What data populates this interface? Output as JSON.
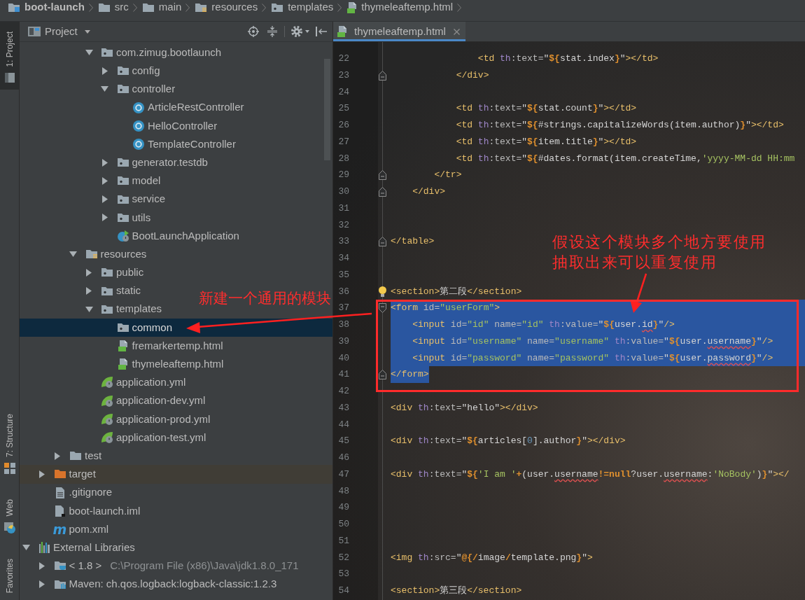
{
  "breadcrumbs": [
    {
      "label": "boot-launch",
      "kind": "module"
    },
    {
      "label": "src",
      "kind": "folder"
    },
    {
      "label": "main",
      "kind": "folder"
    },
    {
      "label": "resources",
      "kind": "resources"
    },
    {
      "label": "templates",
      "kind": "package"
    },
    {
      "label": "thymeleaftemp.html",
      "kind": "html"
    }
  ],
  "tool_strip": [
    {
      "label": "1: Project",
      "kind": "project",
      "selected": true
    },
    {
      "label": "7: Structure",
      "kind": "structure",
      "selected": false
    },
    {
      "label": "Web",
      "kind": "web",
      "selected": false
    },
    {
      "label": "Favorites",
      "kind": "favorites",
      "selected": false
    }
  ],
  "project_panel": {
    "title": "Project",
    "tree": [
      {
        "children": [
          {
            "children": [
              {
                "children": [
                  {
                    "children": [
                      {
                        "label": "com.zimug.bootlaunch",
                        "kind": "package",
                        "expanded": true,
                        "selected": false,
                        "children": [
                          {
                            "label": "config",
                            "kind": "package",
                            "expanded": false,
                            "selected": false
                          },
                          {
                            "label": "controller",
                            "kind": "package",
                            "expanded": true,
                            "selected": false,
                            "children": [
                              {
                                "label": "ArticleRestController",
                                "kind": "class",
                                "selected": false
                              },
                              {
                                "label": "HelloController",
                                "kind": "class",
                                "selected": false
                              },
                              {
                                "label": "TemplateController",
                                "kind": "class",
                                "selected": false
                              }
                            ]
                          },
                          {
                            "label": "generator.testdb",
                            "kind": "package",
                            "expanded": false,
                            "selected": false
                          },
                          {
                            "label": "model",
                            "kind": "package",
                            "expanded": false,
                            "selected": false
                          },
                          {
                            "label": "service",
                            "kind": "package",
                            "expanded": false,
                            "selected": false
                          },
                          {
                            "label": "utils",
                            "kind": "package",
                            "expanded": false,
                            "selected": false
                          },
                          {
                            "label": "BootLaunchApplication",
                            "kind": "boot-class",
                            "selected": false
                          }
                        ]
                      }
                    ]
                  },
                  {
                    "label": "resources",
                    "kind": "resources",
                    "expanded": true,
                    "selected": false,
                    "children": [
                      {
                        "label": "public",
                        "kind": "package",
                        "expanded": false,
                        "selected": false
                      },
                      {
                        "label": "static",
                        "kind": "package",
                        "expanded": false,
                        "selected": false
                      },
                      {
                        "label": "templates",
                        "kind": "package",
                        "expanded": true,
                        "selected": false,
                        "children": [
                          {
                            "label": "common",
                            "kind": "package",
                            "selected": true
                          },
                          {
                            "label": "fremarkertemp.html",
                            "kind": "html",
                            "selected": false
                          },
                          {
                            "label": "thymeleaftemp.html",
                            "kind": "html",
                            "selected": false
                          }
                        ]
                      },
                      {
                        "label": "application.yml",
                        "kind": "spring-config",
                        "selected": false
                      },
                      {
                        "label": "application-dev.yml",
                        "kind": "spring-config",
                        "selected": false
                      },
                      {
                        "label": "application-prod.yml",
                        "kind": "spring-config",
                        "selected": false
                      },
                      {
                        "label": "application-test.yml",
                        "kind": "spring-config",
                        "selected": false
                      }
                    ]
                  }
                ]
              },
              {
                "label": "test",
                "kind": "folder",
                "expanded": false,
                "selected": false
              }
            ]
          },
          {
            "label": "target",
            "kind": "excluded-folder",
            "expanded": false,
            "selected": false
          },
          {
            "label": ".gitignore",
            "kind": "text-file",
            "selected": false
          },
          {
            "label": "boot-launch.iml",
            "kind": "module-file",
            "selected": false
          },
          {
            "label": "pom.xml",
            "kind": "maven",
            "glyph": "m",
            "selected": false
          }
        ]
      },
      {
        "label": "External Libraries",
        "kind": "libraries",
        "expanded": true,
        "selected": false,
        "children": [
          {
            "label": "< 1.8 >",
            "detail": "C:\\Program File (x86)\\Java\\jdk1.8.0_171",
            "kind": "jdk",
            "expanded": false,
            "selected": false
          },
          {
            "label": "Maven: ch.qos.logback:logback-classic:1.2.3",
            "kind": "library",
            "expanded": false,
            "selected": false
          }
        ]
      }
    ]
  },
  "editor": {
    "tabs": [
      {
        "label": "thymeleaftemp.html",
        "kind": "html",
        "selected": true
      }
    ],
    "lines": [
      {
        "number": "22",
        "tokens": [
          {
            "kind": "tag",
            "text": "                <td"
          },
          {
            "kind": "ns",
            "text": " th"
          },
          {
            "kind": "attr",
            "text": ":text="
          },
          {
            "kind": "expr",
            "text": "\""
          },
          {
            "kind": "op",
            "text": "${"
          },
          {
            "kind": "expr",
            "text": "stat.index"
          },
          {
            "kind": "op",
            "text": "}"
          },
          {
            "kind": "expr",
            "text": "\""
          },
          {
            "kind": "tag",
            "text": "></td>"
          }
        ]
      },
      {
        "number": "23",
        "fold_end": true,
        "tokens": [
          {
            "kind": "tag",
            "text": "            </div>"
          }
        ]
      },
      {
        "number": "24"
      },
      {
        "number": "25",
        "tokens": [
          {
            "kind": "tag",
            "text": "            <td"
          },
          {
            "kind": "ns",
            "text": " th"
          },
          {
            "kind": "attr",
            "text": ":text="
          },
          {
            "kind": "expr",
            "text": "\""
          },
          {
            "kind": "op",
            "text": "${"
          },
          {
            "kind": "expr",
            "text": "stat.count"
          },
          {
            "kind": "op",
            "text": "}"
          },
          {
            "kind": "expr",
            "text": "\""
          },
          {
            "kind": "tag",
            "text": "></td>"
          }
        ]
      },
      {
        "number": "26",
        "tokens": [
          {
            "kind": "tag",
            "text": "            <td"
          },
          {
            "kind": "ns",
            "text": " th"
          },
          {
            "kind": "attr",
            "text": ":text="
          },
          {
            "kind": "expr",
            "text": "\""
          },
          {
            "kind": "op",
            "text": "${"
          },
          {
            "kind": "expr",
            "text": "#strings.capitalizeWords(item.author)"
          },
          {
            "kind": "op",
            "text": "}"
          },
          {
            "kind": "expr",
            "text": "\""
          },
          {
            "kind": "tag",
            "text": "></td>"
          }
        ]
      },
      {
        "number": "27",
        "tokens": [
          {
            "kind": "tag",
            "text": "            <td"
          },
          {
            "kind": "ns",
            "text": " th"
          },
          {
            "kind": "attr",
            "text": ":text="
          },
          {
            "kind": "expr",
            "text": "\""
          },
          {
            "kind": "op",
            "text": "${"
          },
          {
            "kind": "expr",
            "text": "item.title"
          },
          {
            "kind": "op",
            "text": "}"
          },
          {
            "kind": "expr",
            "text": "\""
          },
          {
            "kind": "tag",
            "text": "></td>"
          }
        ]
      },
      {
        "number": "28",
        "tokens": [
          {
            "kind": "tag",
            "text": "            <td"
          },
          {
            "kind": "ns",
            "text": " th"
          },
          {
            "kind": "attr",
            "text": ":text="
          },
          {
            "kind": "expr",
            "text": "\""
          },
          {
            "kind": "op",
            "text": "${"
          },
          {
            "kind": "expr",
            "text": "#dates.format(item.createTime,"
          },
          {
            "kind": "value",
            "text": "'yyyy-MM-dd HH:mm"
          }
        ]
      },
      {
        "number": "29",
        "fold_end": true,
        "tokens": [
          {
            "kind": "tag",
            "text": "        </tr>"
          }
        ]
      },
      {
        "number": "30",
        "fold_end": true,
        "tokens": [
          {
            "kind": "tag",
            "text": "    </div>"
          }
        ]
      },
      {
        "number": "31"
      },
      {
        "number": "32"
      },
      {
        "number": "33",
        "fold_end": true,
        "tokens": [
          {
            "kind": "tag",
            "text": "</table>"
          }
        ]
      },
      {
        "number": "34"
      },
      {
        "number": "35"
      },
      {
        "number": "36",
        "bulb": true,
        "tokens": [
          {
            "kind": "tag",
            "text": "<section>"
          },
          {
            "kind": "text",
            "text": "第二段"
          },
          {
            "kind": "tag",
            "text": "</section>"
          }
        ]
      },
      {
        "number": "37",
        "fold_start": true,
        "line_selected": true,
        "tokens": [
          {
            "kind": "tag",
            "text": "<form"
          },
          {
            "kind": "attr",
            "text": " id="
          },
          {
            "kind": "value",
            "text": "\"userForm\""
          },
          {
            "kind": "tag",
            "text": ">"
          }
        ]
      },
      {
        "number": "38",
        "line_selected": true,
        "tokens": [
          {
            "kind": "tag",
            "text": "    <input"
          },
          {
            "kind": "attr",
            "text": " id="
          },
          {
            "kind": "value",
            "text": "\"id\""
          },
          {
            "kind": "attr",
            "text": " name="
          },
          {
            "kind": "value",
            "text": "\"id\""
          },
          {
            "kind": "ns",
            "text": " th"
          },
          {
            "kind": "attr",
            "text": ":value="
          },
          {
            "kind": "expr",
            "text": "\""
          },
          {
            "kind": "op",
            "text": "${"
          },
          {
            "kind": "expr",
            "text": "user."
          },
          {
            "kind": "typo",
            "text": "id"
          },
          {
            "kind": "op",
            "text": "}"
          },
          {
            "kind": "expr",
            "text": "\""
          },
          {
            "kind": "tag",
            "text": "/>"
          }
        ]
      },
      {
        "number": "39",
        "line_selected": true,
        "tokens": [
          {
            "kind": "tag",
            "text": "    <input"
          },
          {
            "kind": "attr",
            "text": " id="
          },
          {
            "kind": "value",
            "text": "\"username\""
          },
          {
            "kind": "attr",
            "text": " name="
          },
          {
            "kind": "value",
            "text": "\"username\""
          },
          {
            "kind": "ns",
            "text": " th"
          },
          {
            "kind": "attr",
            "text": ":value="
          },
          {
            "kind": "expr",
            "text": "\""
          },
          {
            "kind": "op",
            "text": "${"
          },
          {
            "kind": "expr",
            "text": "user."
          },
          {
            "kind": "typo",
            "text": "username"
          },
          {
            "kind": "op",
            "text": "}"
          },
          {
            "kind": "expr",
            "text": "\""
          },
          {
            "kind": "tag",
            "text": "/>"
          }
        ]
      },
      {
        "number": "40",
        "line_selected": true,
        "tokens": [
          {
            "kind": "tag",
            "text": "    <input"
          },
          {
            "kind": "attr",
            "text": " id="
          },
          {
            "kind": "value",
            "text": "\"password\""
          },
          {
            "kind": "attr",
            "text": " name="
          },
          {
            "kind": "value",
            "text": "\"password\""
          },
          {
            "kind": "ns",
            "text": " th"
          },
          {
            "kind": "attr",
            "text": ":value="
          },
          {
            "kind": "expr",
            "text": "\""
          },
          {
            "kind": "op",
            "text": "${"
          },
          {
            "kind": "expr",
            "text": "user."
          },
          {
            "kind": "typo",
            "text": "password"
          },
          {
            "kind": "op",
            "text": "}"
          },
          {
            "kind": "expr",
            "text": "\""
          },
          {
            "kind": "tag",
            "text": "/>"
          }
        ]
      },
      {
        "number": "41",
        "fold_end": true,
        "text_selected": true,
        "tokens": [
          {
            "kind": "tag",
            "text": "</form>"
          }
        ]
      },
      {
        "number": "42"
      },
      {
        "number": "43",
        "tokens": [
          {
            "kind": "tag",
            "text": "<div"
          },
          {
            "kind": "ns",
            "text": " th"
          },
          {
            "kind": "attr",
            "text": ":text="
          },
          {
            "kind": "expr",
            "text": "\"hello\""
          },
          {
            "kind": "tag",
            "text": "></div>"
          }
        ]
      },
      {
        "number": "44"
      },
      {
        "number": "45",
        "tokens": [
          {
            "kind": "tag",
            "text": "<div"
          },
          {
            "kind": "ns",
            "text": " th"
          },
          {
            "kind": "attr",
            "text": ":text="
          },
          {
            "kind": "expr",
            "text": "\""
          },
          {
            "kind": "op",
            "text": "${"
          },
          {
            "kind": "expr",
            "text": "articles["
          },
          {
            "kind": "num",
            "text": "0"
          },
          {
            "kind": "expr",
            "text": "].author"
          },
          {
            "kind": "op",
            "text": "}"
          },
          {
            "kind": "expr",
            "text": "\""
          },
          {
            "kind": "tag",
            "text": "></div>"
          }
        ]
      },
      {
        "number": "46"
      },
      {
        "number": "47",
        "tokens": [
          {
            "kind": "tag",
            "text": "<div"
          },
          {
            "kind": "ns",
            "text": " th"
          },
          {
            "kind": "attr",
            "text": ":text="
          },
          {
            "kind": "expr",
            "text": "\""
          },
          {
            "kind": "op",
            "text": "${"
          },
          {
            "kind": "value",
            "text": "'I am '"
          },
          {
            "kind": "op",
            "text": "+"
          },
          {
            "kind": "expr",
            "text": "(user."
          },
          {
            "kind": "typo",
            "text": "username"
          },
          {
            "kind": "op",
            "text": "!=null"
          },
          {
            "kind": "expr",
            "text": "?user."
          },
          {
            "kind": "typo",
            "text": "username"
          },
          {
            "kind": "expr",
            "text": ":"
          },
          {
            "kind": "value",
            "text": "'NoBody'"
          },
          {
            "kind": "expr",
            "text": ")"
          },
          {
            "kind": "op",
            "text": "}"
          },
          {
            "kind": "expr",
            "text": "\""
          },
          {
            "kind": "tag",
            "text": "></"
          }
        ]
      },
      {
        "number": "48"
      },
      {
        "number": "49"
      },
      {
        "number": "50"
      },
      {
        "number": "51"
      },
      {
        "number": "52",
        "tokens": [
          {
            "kind": "tag",
            "text": "<img"
          },
          {
            "kind": "ns",
            "text": " th"
          },
          {
            "kind": "attr",
            "text": ":src="
          },
          {
            "kind": "expr",
            "text": "\""
          },
          {
            "kind": "op",
            "text": "@{/"
          },
          {
            "kind": "expr",
            "text": "image"
          },
          {
            "kind": "op",
            "text": "/"
          },
          {
            "kind": "expr",
            "text": "template.png"
          },
          {
            "kind": "op",
            "text": "}"
          },
          {
            "kind": "expr",
            "text": "\""
          },
          {
            "kind": "tag",
            "text": ">"
          }
        ]
      },
      {
        "number": "53"
      },
      {
        "number": "54",
        "tokens": [
          {
            "kind": "tag",
            "text": "<section>"
          },
          {
            "kind": "text",
            "text": "第三段"
          },
          {
            "kind": "tag",
            "text": "</section>"
          }
        ]
      }
    ]
  },
  "annotations": {
    "left_note": "新建一个通用的模块",
    "right_note": [
      "假设这个模块多个地方要使用",
      "抽取出来可以重复使用"
    ]
  }
}
